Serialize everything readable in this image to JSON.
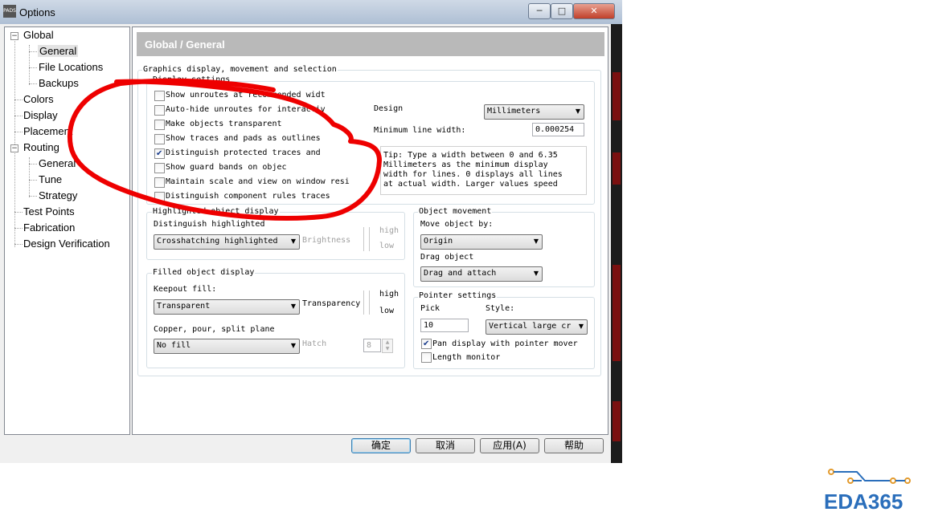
{
  "window": {
    "title": "Options",
    "app_icon_label": "PADS",
    "buttons": {
      "minimize": "─",
      "maximize": "□",
      "close": "✕"
    }
  },
  "tree": {
    "items": [
      {
        "label": "Global",
        "expanded": true
      },
      {
        "label": "General",
        "selected": true
      },
      {
        "label": "File Locations"
      },
      {
        "label": "Backups"
      },
      {
        "label": "Colors"
      },
      {
        "label": "Display"
      },
      {
        "label": "Placement"
      },
      {
        "label": "Routing",
        "expanded": true
      },
      {
        "label": "General"
      },
      {
        "label": "Tune"
      },
      {
        "label": "Strategy"
      },
      {
        "label": "Test Points"
      },
      {
        "label": "Fabrication"
      },
      {
        "label": "Design Verification"
      }
    ],
    "expander_glyph": "−"
  },
  "panel": {
    "header": "Global / General",
    "graphics_group": "Graphics display, movement and selection",
    "display_settings": {
      "label": "Display settings",
      "checkboxes": [
        {
          "label": "Show unroutes at recommended widt",
          "checked": false
        },
        {
          "label": "Auto-hide unroutes for interactiv",
          "checked": false
        },
        {
          "label": "Make objects transparent",
          "checked": false
        },
        {
          "label": "Show traces and pads as outlines",
          "checked": false
        },
        {
          "label": "Distinguish protected traces and",
          "checked": true
        },
        {
          "label": "Show guard bands on objec",
          "checked": false
        },
        {
          "label": "Maintain scale and view on window resi",
          "checked": false
        },
        {
          "label": "Distinguish component rules traces",
          "checked": false
        }
      ],
      "design_label": "Design",
      "design_units": "Millimeters",
      "min_line_width_label": "Minimum line width:",
      "min_line_width_value": "0.000254",
      "tip": [
        "Tip: Type a width between 0 and 6.35",
        "Millimeters as the minimum display",
        "width for lines. 0 displays all lines",
        "at actual width. Larger values speed"
      ]
    },
    "highlighted": {
      "label": "Highlighted object display",
      "distinguish_label": "Distinguish highlighted",
      "mode": "Crosshatching highlighted",
      "brightness_label": "Brightness",
      "high": "high",
      "low": "low"
    },
    "filled": {
      "label": "Filled object display",
      "keepout_label": "Keepout fill:",
      "keepout_value": "Transparent",
      "transparency_label": "Transparency",
      "high": "high",
      "low": "low",
      "copper_label": "Copper, pour, split plane",
      "copper_value": "No fill",
      "hatch_label": "Hatch",
      "hatch_value": "8"
    },
    "object_movement": {
      "label": "Object movement",
      "move_label": "Move object by:",
      "move_value": "Origin",
      "drag_label": "Drag object",
      "drag_value": "Drag and attach"
    },
    "pointer": {
      "label": "Pointer settings",
      "pick_label": "Pick",
      "pick_value": "10",
      "style_label": "Style:",
      "style_value": "Vertical large cr",
      "pan_label": "Pan display with pointer mover",
      "pan_checked": true,
      "length_label": "Length monitor",
      "length_checked": false
    }
  },
  "footer": {
    "ok": "确定",
    "cancel": "取消",
    "apply": "应用(A)",
    "help": "帮助"
  },
  "watermark": {
    "text": "EDA365"
  },
  "colors": {
    "annotation_red": "#ee0000",
    "logo_blue": "#2a6ebb",
    "circuit_orange": "#e39a2c"
  }
}
